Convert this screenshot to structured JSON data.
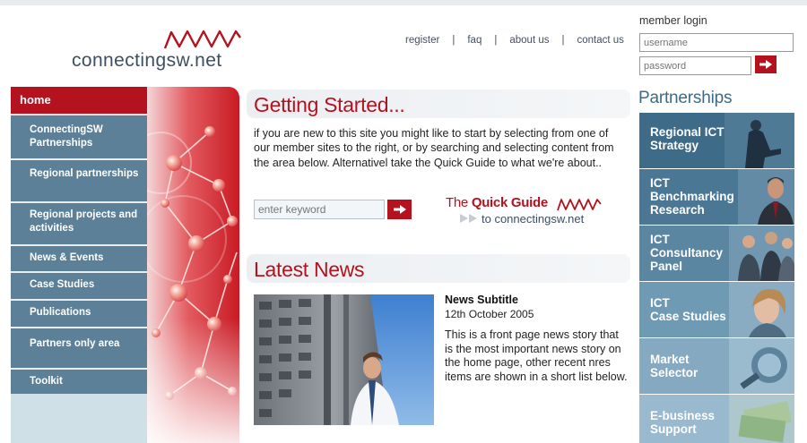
{
  "logo": {
    "text_prefix": "connecting",
    "text_sw": "sw",
    "text_suffix": ".net"
  },
  "topnav": {
    "register": "register",
    "faq": "faq",
    "about": "about us",
    "contact": "contact us",
    "sep": "|"
  },
  "login": {
    "title": "member login",
    "username_placeholder": "username",
    "password_placeholder": "password"
  },
  "leftnav": {
    "home": "home",
    "items": [
      "ConnectingSW Partnerships",
      "Regional partnerships",
      "Regional projects and activities",
      "News & Events",
      "Case Studies",
      "Publications",
      "Partners only area",
      "Toolkit"
    ]
  },
  "getting_started": {
    "title": "Getting Started...",
    "body": "if you are new to this site you might like to start by selecting from one of our member sites to the right, or by searching and selecting content from the area below.    Alternativel take the Quick Guide to what we're about..",
    "keyword_placeholder": "enter keyword"
  },
  "quick_guide": {
    "prefix": "The",
    "bold": "Quick Guide",
    "line2_to": "to connecting",
    "line2_sw": "sw",
    "line2_net": ".net"
  },
  "latest_news": {
    "title": "Latest News",
    "subtitle": "News Subtitle",
    "date": "12th October 2005",
    "body": "This is a front page news story that is the most important news story on the home page, other recent nres items are shown in a short list below."
  },
  "partnerships": {
    "title": "Partnerships",
    "cards": [
      {
        "line1": "Regional ICT",
        "line2": "Strategy",
        "line3": ""
      },
      {
        "line1": "ICT",
        "line2": "Benchmarking",
        "line3": "Research"
      },
      {
        "line1": "ICT",
        "line2": "Consultancy",
        "line3": "Panel"
      },
      {
        "line1": "ICT",
        "line2": "Case Studies",
        "line3": ""
      },
      {
        "line1": "Market",
        "line2": "Selector",
        "line3": ""
      },
      {
        "line1": "E-business",
        "line2": "Support",
        "line3": ""
      }
    ]
  },
  "colors": {
    "brand_red": "#b3121e",
    "nav_blue": "#5b8097",
    "text_navy": "#3d4f63",
    "partner_blue": "#3e6a85"
  },
  "icons": {
    "go_button": "arrow-right-icon",
    "logo_mark": "wave-icon",
    "quick_guide_arrows": "double-arrow-icon"
  }
}
